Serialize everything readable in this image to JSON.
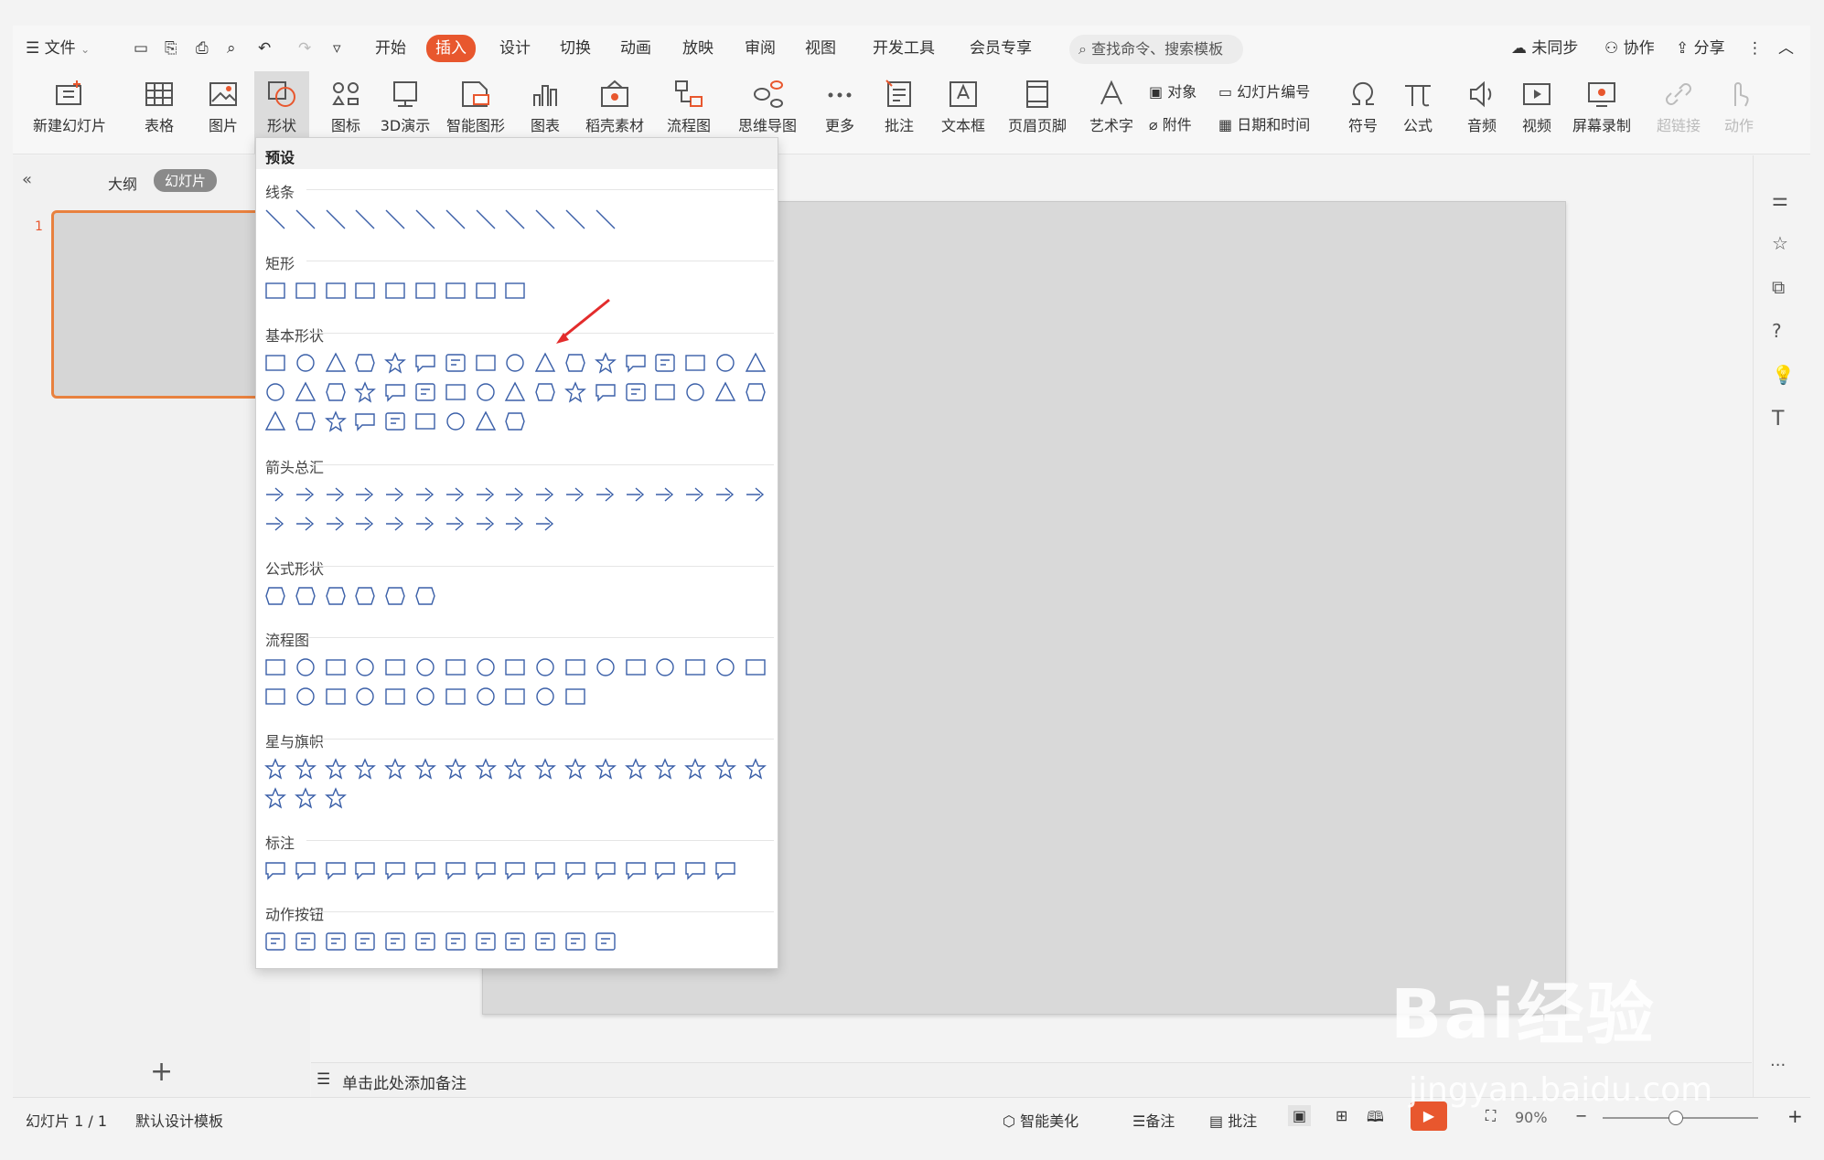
{
  "colors": {
    "accent": "#e8572e",
    "shape_stroke": "#3a5fa8",
    "slide_border": "#e8813f"
  },
  "menubar": {
    "file": "文件",
    "tabs": [
      "开始",
      "插入",
      "设计",
      "切换",
      "动画",
      "放映",
      "审阅",
      "视图",
      "开发工具",
      "会员专享"
    ],
    "active_tab": "插入",
    "search_placeholder": "查找命令、搜索模板",
    "right": {
      "sync": "未同步",
      "collab": "协作",
      "share": "分享"
    }
  },
  "toolbar": {
    "new_slide": "新建幻灯片",
    "table": "表格",
    "picture": "图片",
    "shape": "形状",
    "icon": "图标",
    "three_d": "3D演示",
    "smart_graphic": "智能图形",
    "chart": "图表",
    "docer": "稻壳素材",
    "flowchart": "流程图",
    "mindmap": "思维导图",
    "more": "更多",
    "comment": "批注",
    "textbox": "文本框",
    "header_footer": "页眉页脚",
    "wordart": "艺术字",
    "object": "对象",
    "slide_number": "幻灯片编号",
    "attachment": "附件",
    "datetime": "日期和时间",
    "symbol": "符号",
    "formula": "公式",
    "audio": "音频",
    "video": "视频",
    "screen_record": "屏幕录制",
    "hyperlink": "超链接",
    "action": "动作"
  },
  "leftpanel": {
    "outline": "大纲",
    "slides": "幻灯片",
    "slide_index": "1"
  },
  "shapes_panel": {
    "header": "预设",
    "sections": [
      "线条",
      "矩形",
      "基本形状",
      "箭头总汇",
      "公式形状",
      "流程图",
      "星与旗帜",
      "标注",
      "动作按钮"
    ]
  },
  "notes": {
    "placeholder": "单击此处添加备注"
  },
  "status": {
    "slide_count": "幻灯片 1 / 1",
    "template": "默认设计模板",
    "beautify": "智能美化",
    "notes": "备注",
    "comment": "批注",
    "zoom": "90%"
  },
  "watermark": {
    "brand": "Bai经验",
    "url": "jingyan.baidu.com"
  }
}
